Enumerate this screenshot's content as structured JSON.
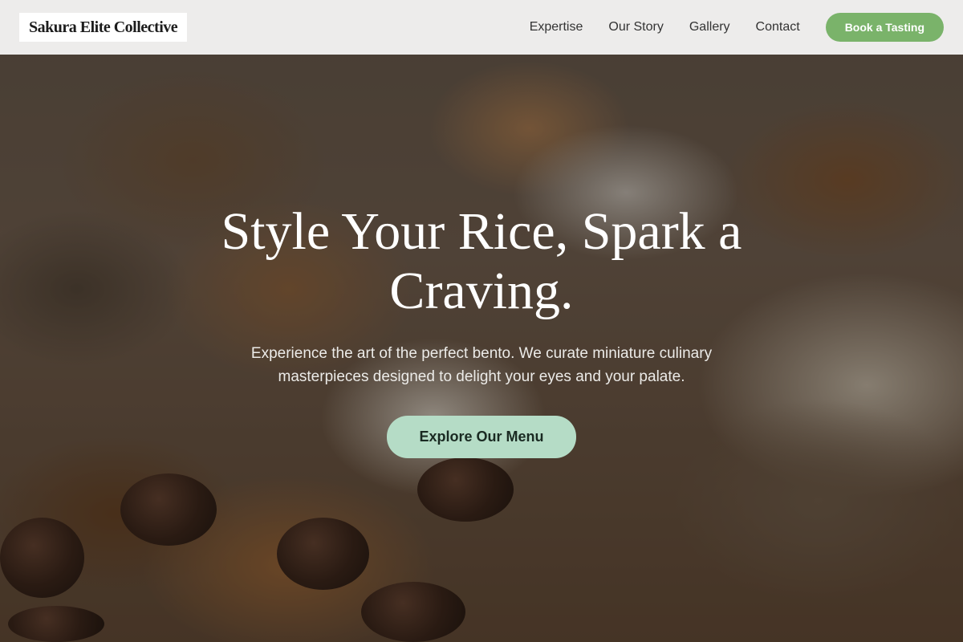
{
  "brand": {
    "logo_text": "Sakura Elite Collective"
  },
  "nav": {
    "items": [
      {
        "label": "Expertise"
      },
      {
        "label": "Our Story"
      },
      {
        "label": "Gallery"
      },
      {
        "label": "Contact"
      }
    ],
    "cta_label": "Book a Tasting"
  },
  "hero": {
    "title": "Style Your Rice, Spark a Craving.",
    "subtitle": "Experience the art of the perfect bento. We curate miniature culinary masterpieces designed to delight your eyes and your palate.",
    "button_label": "Explore Our Menu",
    "background_image": "blurred-pastries-photo"
  },
  "colors": {
    "accent_green": "#7ab36a",
    "hero_button": "#b5dcc6",
    "header_bg": "#f4f4f3"
  }
}
